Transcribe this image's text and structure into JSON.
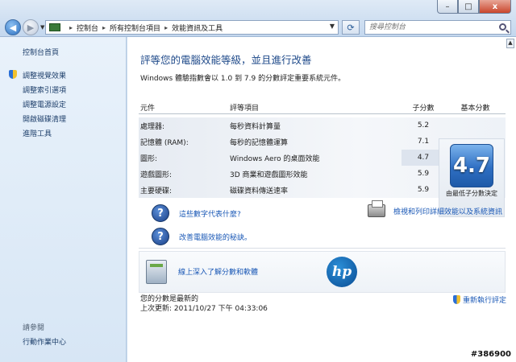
{
  "window": {
    "controls": {
      "min": "–",
      "max": "□",
      "close": "x"
    }
  },
  "addressbar": {
    "crumbs": [
      "控制台",
      "所有控制台項目",
      "效能資訊及工具"
    ],
    "separator": "▸",
    "search_placeholder": "搜尋控制台"
  },
  "sidebar": {
    "home": "控制台首頁",
    "items": [
      {
        "label": "調整視覺效果",
        "shield": true
      },
      {
        "label": "調整索引選項",
        "shield": false
      },
      {
        "label": "調整電源設定",
        "shield": false
      },
      {
        "label": "開啟磁碟清理",
        "shield": false
      },
      {
        "label": "進階工具",
        "shield": false
      }
    ],
    "see_also": "請參閱",
    "action_center": "行動作業中心"
  },
  "main": {
    "heading": "評等您的電腦效能等級，並且進行改善",
    "subtext": "Windows 體驗指數會以 1.0 到 7.9 的分數評定重要系統元件。",
    "table": {
      "headers": {
        "component": "元件",
        "rating": "評等項目",
        "subscore": "子分數",
        "base": "基本分數"
      },
      "rows": [
        {
          "component": "處理器:",
          "rating": "每秒資料計算量",
          "subscore": "5.2"
        },
        {
          "component": "記憶體 (RAM):",
          "rating": "每秒的記憶體運算",
          "subscore": "7.1"
        },
        {
          "component": "圖形:",
          "rating": "Windows Aero 的桌面效能",
          "subscore": "4.7"
        },
        {
          "component": "遊戲圖形:",
          "rating": "3D 商業和遊戲圖形效能",
          "subscore": "5.9"
        },
        {
          "component": "主要硬碟:",
          "rating": "磁碟資料傳送速率",
          "subscore": "5.9"
        }
      ],
      "base_score": "4.7",
      "base_note": "由最低子分數決定"
    },
    "links": [
      "這些數字代表什麼?",
      "改善電腦效能的秘訣。"
    ],
    "print_link": "檢視和列印詳細效能以及系統資訊",
    "offer_link": "線上深入了解分數和軟體",
    "hp_logo": "hp",
    "status_line1": "您的分數是最新的",
    "status_line2": "上次更新: 2011/10/27 下午 04:33:06",
    "rerun": "重新執行評定",
    "question_glyph": "?"
  },
  "watermark": "#386900"
}
